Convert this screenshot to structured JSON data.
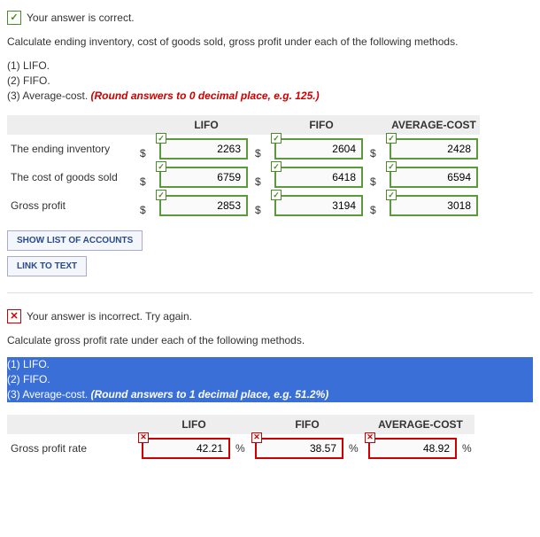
{
  "section1": {
    "status_text": "Your answer is correct.",
    "prompt": "Calculate ending inventory, cost of goods sold, gross profit under each of the following methods.",
    "methods": {
      "m1": "(1) LIFO.",
      "m2": "(2) FIFO.",
      "m3_prefix": "(3) Average-cost. ",
      "m3_note": "(Round answers to 0 decimal place, e.g. 125.)"
    },
    "headers": {
      "c1": "LIFO",
      "c2": "FIFO",
      "c3": "AVERAGE-COST"
    },
    "rows": [
      {
        "label": "The ending inventory",
        "lifo": "2263",
        "fifo": "2604",
        "avg": "2428"
      },
      {
        "label": "The cost of goods sold",
        "lifo": "6759",
        "fifo": "6418",
        "avg": "6594"
      },
      {
        "label": "Gross profit",
        "lifo": "2853",
        "fifo": "3194",
        "avg": "3018"
      }
    ],
    "currency": "$",
    "btn_accounts": "SHOW LIST OF ACCOUNTS",
    "btn_link": "LINK TO TEXT"
  },
  "section2": {
    "status_text": "Your answer is incorrect.  Try again.",
    "prompt": "Calculate gross profit rate under each of the following methods.",
    "methods": {
      "m1": "(1) LIFO.",
      "m2": "(2) FIFO.",
      "m3_prefix": "(3) Average-cost. ",
      "m3_note": "(Round answers to 1 decimal place, e.g. 51.2%)"
    },
    "headers": {
      "c1": "LIFO",
      "c2": "FIFO",
      "c3": "AVERAGE-COST"
    },
    "row": {
      "label": "Gross profit rate",
      "lifo": "42.21",
      "fifo": "38.57",
      "avg": "48.92"
    },
    "pct": "%"
  },
  "icons": {
    "check": "✓",
    "cross": "✕"
  }
}
